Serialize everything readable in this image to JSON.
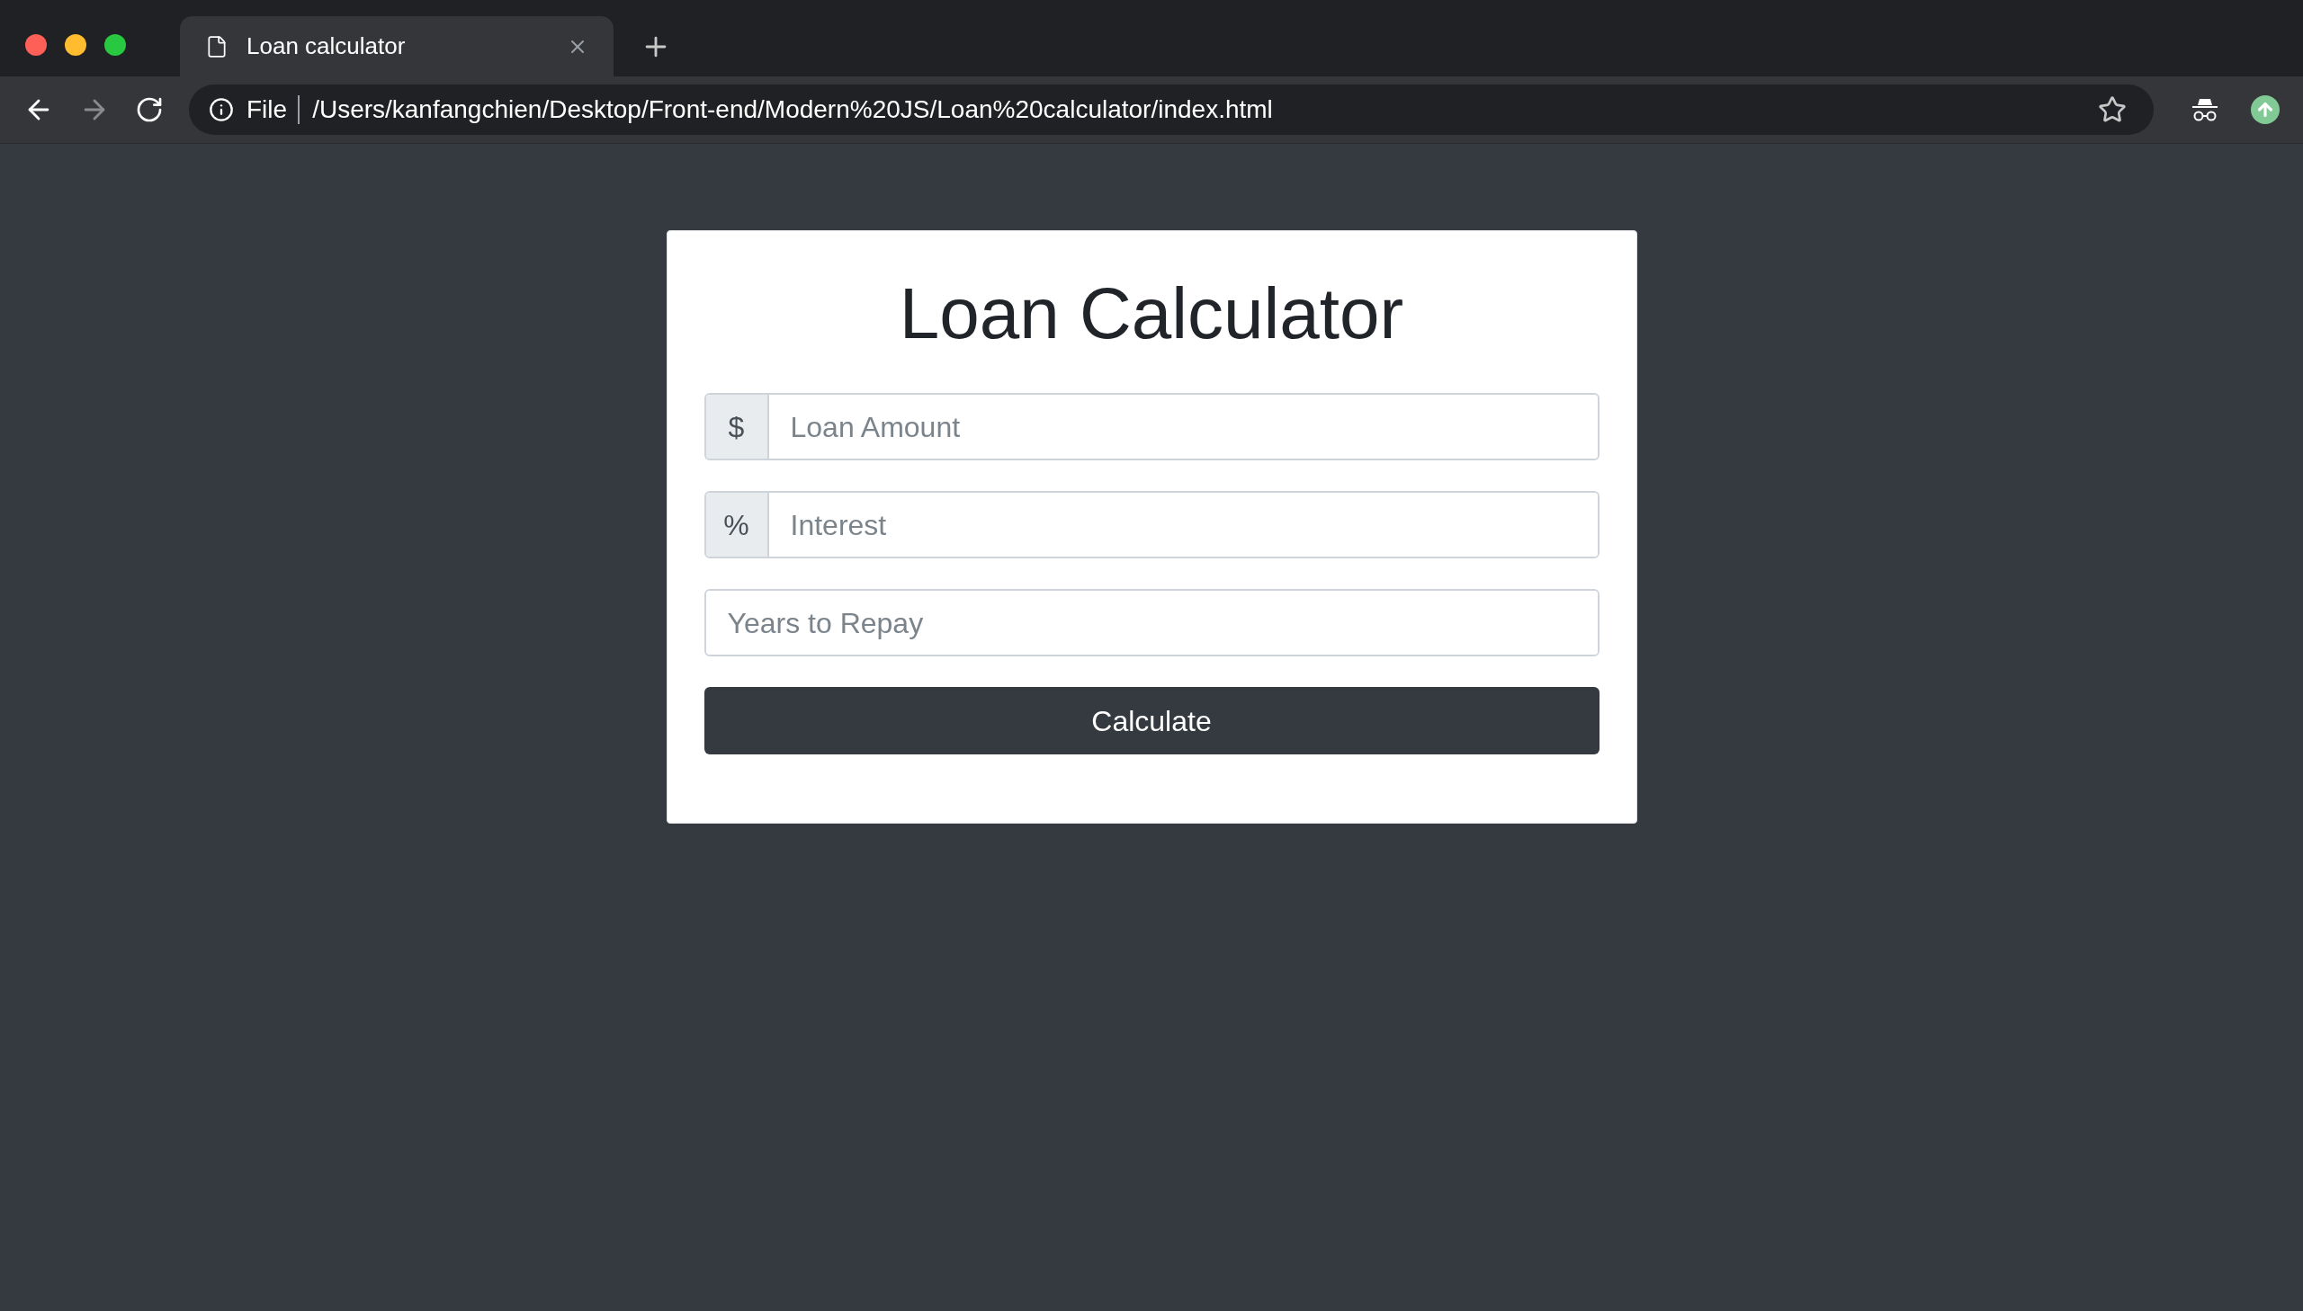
{
  "browser": {
    "tab": {
      "title": "Loan calculator",
      "selected": true
    },
    "address": {
      "scheme_label": "File",
      "url": "/Users/kanfangchien/Desktop/Front-end/Modern%20JS/Loan%20calculator/index.html"
    }
  },
  "card": {
    "title": "Loan Calculator",
    "fields": [
      {
        "prefix": "$",
        "placeholder": "Loan Amount"
      },
      {
        "prefix": "%",
        "placeholder": "Interest"
      },
      {
        "placeholder": "Years to Repay"
      }
    ],
    "button": "Calculate"
  }
}
